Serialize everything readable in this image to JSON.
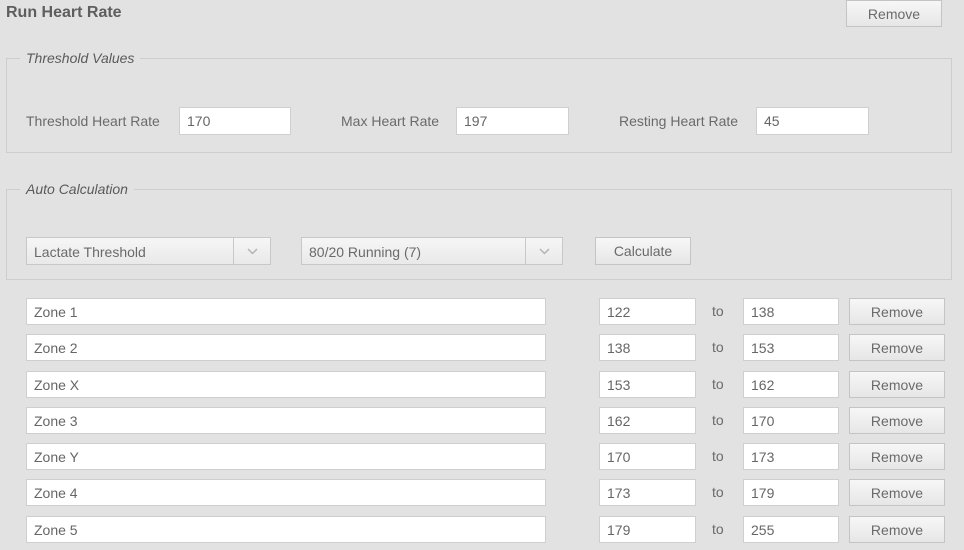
{
  "header": {
    "title": "Run Heart Rate",
    "remove_label": "Remove"
  },
  "threshold_values": {
    "legend": "Threshold Values",
    "threshold_hr": {
      "label": "Threshold Heart Rate",
      "value": "170"
    },
    "max_hr": {
      "label": "Max Heart Rate",
      "value": "197"
    },
    "resting_hr": {
      "label": "Resting Heart Rate",
      "value": "45"
    }
  },
  "auto_calculation": {
    "legend": "Auto Calculation",
    "method_select": {
      "selected": "Lactate Threshold"
    },
    "model_select": {
      "selected": "80/20 Running (7)"
    },
    "calculate_label": "Calculate"
  },
  "zones": {
    "to_label": "to",
    "remove_label": "Remove",
    "rows": [
      {
        "name": "Zone 1",
        "from": "122",
        "to": "138"
      },
      {
        "name": "Zone 2",
        "from": "138",
        "to": "153"
      },
      {
        "name": "Zone X",
        "from": "153",
        "to": "162"
      },
      {
        "name": "Zone 3",
        "from": "162",
        "to": "170"
      },
      {
        "name": "Zone Y",
        "from": "170",
        "to": "173"
      },
      {
        "name": "Zone 4",
        "from": "173",
        "to": "179"
      },
      {
        "name": "Zone 5",
        "from": "179",
        "to": "255"
      }
    ]
  }
}
